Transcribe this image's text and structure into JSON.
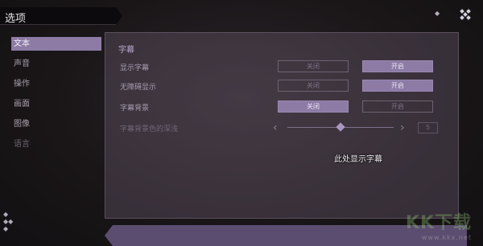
{
  "window": {
    "title": "选项"
  },
  "sidebar": {
    "items": [
      {
        "label": "文本",
        "active": true
      },
      {
        "label": "声音",
        "active": false
      },
      {
        "label": "操作",
        "active": false
      },
      {
        "label": "画面",
        "active": false
      },
      {
        "label": "图像",
        "active": false
      },
      {
        "label": "语言",
        "active": false
      }
    ]
  },
  "panel": {
    "title": "字幕",
    "rows": [
      {
        "label": "显示字幕",
        "options": [
          "关闭",
          "开启"
        ],
        "selected": "开启"
      },
      {
        "label": "无障碍显示",
        "options": [
          "关闭",
          "开启"
        ],
        "selected": "开启"
      },
      {
        "label": "字幕背景",
        "options": [
          "关闭",
          "开启"
        ],
        "selected": "关闭"
      }
    ],
    "slider": {
      "label": "字幕背景色的深浅",
      "value": "5",
      "min": 0,
      "max": 10
    },
    "preview_text": "此处显示字幕"
  },
  "watermark": {
    "text": "KK下载",
    "url": "www.kkx.net"
  },
  "colors": {
    "accent": "#8d7ba6",
    "panel": "#4a3f4e",
    "background": "#1a1618"
  }
}
